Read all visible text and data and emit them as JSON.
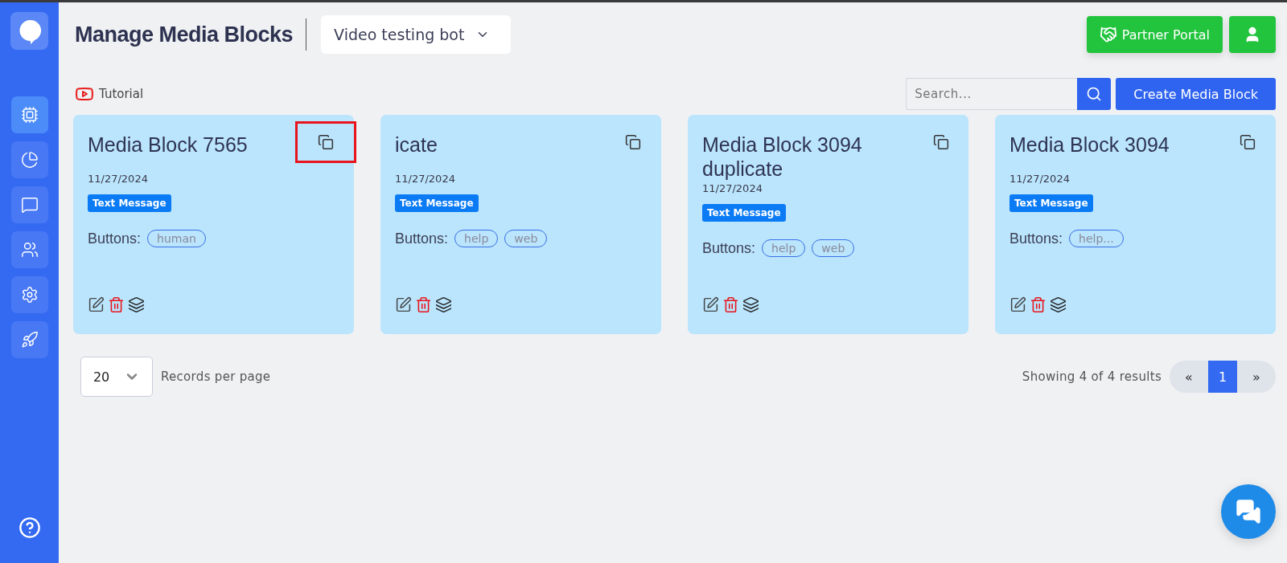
{
  "sidebar": {
    "items": [
      {
        "kind": "chip",
        "selected": true
      },
      {
        "kind": "chart",
        "selected": false
      },
      {
        "kind": "message",
        "selected": false
      },
      {
        "kind": "users",
        "selected": false
      },
      {
        "kind": "settings",
        "selected": false
      },
      {
        "kind": "rocket",
        "selected": false
      }
    ]
  },
  "header": {
    "title": "Manage Media Blocks",
    "bot_selector": "Video testing bot",
    "partner_button": "Partner Portal"
  },
  "toolbar": {
    "tutorial": "Tutorial",
    "search": {
      "placeholder": "Search..."
    },
    "create_button": "Create Media Block"
  },
  "cards": [
    {
      "title": "Media Block 7565",
      "date": "11/27/2024",
      "type": "Text Message",
      "buttons_label": "Buttons:",
      "buttons": [
        "human"
      ],
      "highlighted": true
    },
    {
      "title": "icate",
      "date": "11/27/2024",
      "type": "Text Message",
      "buttons_label": "Buttons:",
      "buttons": [
        "help",
        "web"
      ],
      "highlighted": false
    },
    {
      "title": "Media Block 3094 duplicate",
      "date": "11/27/2024",
      "type": "Text Message",
      "buttons_label": "Buttons:",
      "buttons": [
        "help",
        "web"
      ],
      "highlighted": false
    },
    {
      "title": "Media Block 3094",
      "date": "11/27/2024",
      "type": "Text Message",
      "buttons_label": "Buttons:",
      "buttons": [
        "help..."
      ],
      "highlighted": false
    }
  ],
  "footer": {
    "per_page": "20",
    "per_page_label": "Records per page",
    "showing": "Showing 4 of 4 results",
    "prev": "«",
    "pages": [
      {
        "label": "1",
        "selected": true
      }
    ],
    "next": "»"
  }
}
